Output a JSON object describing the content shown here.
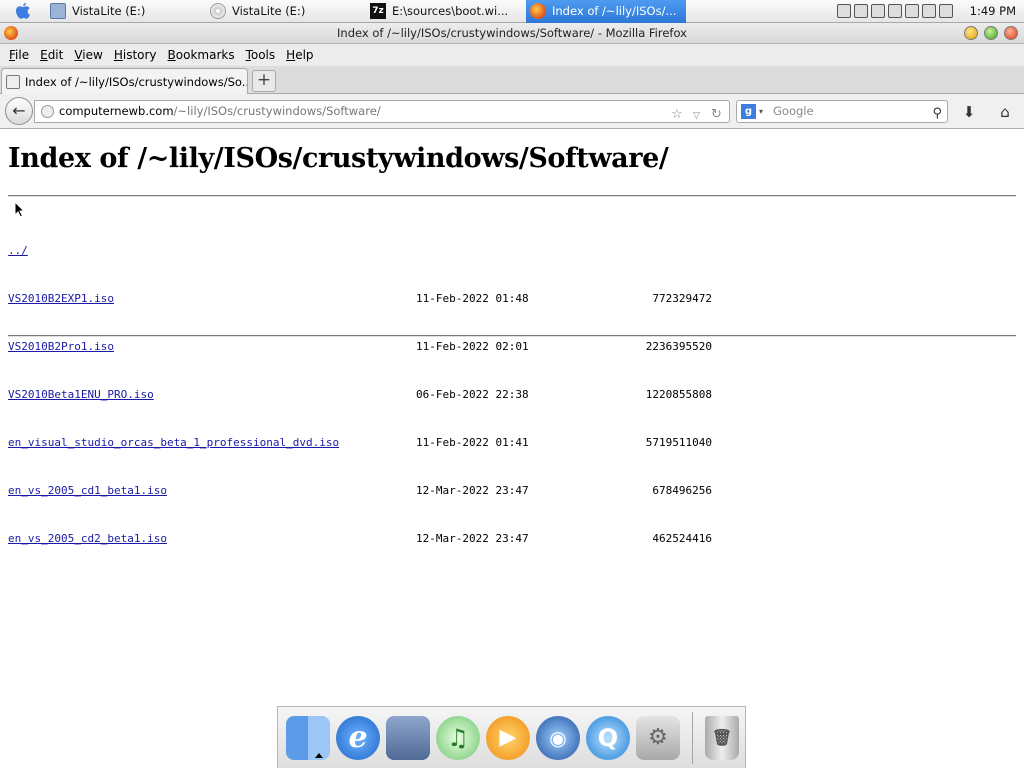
{
  "taskbar": {
    "tasks": [
      {
        "label": "VistaLite (E:)"
      },
      {
        "label": "VistaLite (E:)"
      },
      {
        "label": "E:\\sources\\boot.wi..."
      },
      {
        "label": "Index of /~lily/ISOs/..."
      }
    ],
    "clock": "1:49 PM"
  },
  "window": {
    "title": "Index of /~lily/ISOs/crustywindows/Software/ - Mozilla Firefox"
  },
  "menubar": {
    "items": [
      {
        "key": "F",
        "rest": "ile"
      },
      {
        "key": "E",
        "rest": "dit"
      },
      {
        "key": "V",
        "rest": "iew"
      },
      {
        "key": "H",
        "rest": "istory"
      },
      {
        "key": "B",
        "rest": "ookmarks"
      },
      {
        "key": "T",
        "rest": "ools"
      },
      {
        "key": "H",
        "rest": "elp"
      }
    ]
  },
  "tabs": {
    "active_label": "Index of /~lily/ISOs/crustywindows/So...",
    "new_tab_symbol": "+"
  },
  "navbar": {
    "url_host": "computernewb.com",
    "url_path": "/~lily/ISOs/crustywindows/Software/",
    "search_placeholder": "Google",
    "search_engine_letter": "g"
  },
  "page": {
    "heading": "Index of /~lily/ISOs/crustywindows/Software/",
    "parent_link": "../",
    "files": [
      {
        "name": "VS2010B2EXP1.iso",
        "date": "11-Feb-2022 01:48",
        "size": "772329472"
      },
      {
        "name": "VS2010B2Pro1.iso",
        "date": "11-Feb-2022 02:01",
        "size": "2236395520"
      },
      {
        "name": "VS2010Beta1ENU_PRO.iso",
        "date": "06-Feb-2022 22:38",
        "size": "1220855808"
      },
      {
        "name": "en_visual_studio_orcas_beta_1_professional_dvd.iso",
        "date": "11-Feb-2022 01:41",
        "size": "5719511040"
      },
      {
        "name": "en_vs_2005_cd1_beta1.iso",
        "date": "12-Mar-2022 23:47",
        "size": "678496256"
      },
      {
        "name": "en_vs_2005_cd2_beta1.iso",
        "date": "12-Mar-2022 23:47",
        "size": "462524416"
      }
    ]
  },
  "dock": {
    "items": [
      {
        "icon": "finder-icon",
        "color": "#3a7bd5"
      },
      {
        "icon": "internet-explorer-icon",
        "color": "#1e66c8"
      },
      {
        "icon": "mail-icon",
        "color": "#6b7fa3"
      },
      {
        "icon": "itunes-icon",
        "color": "#4aa84a"
      },
      {
        "icon": "media-player-icon",
        "color": "#f0a020"
      },
      {
        "icon": "media-center-icon",
        "color": "#2a5fb0"
      },
      {
        "icon": "quicktime-icon",
        "color": "#1c7fd6"
      },
      {
        "icon": "system-preferences-icon",
        "color": "#9a9a9a"
      },
      {
        "icon": "trash-icon",
        "color": "#888888"
      }
    ]
  }
}
